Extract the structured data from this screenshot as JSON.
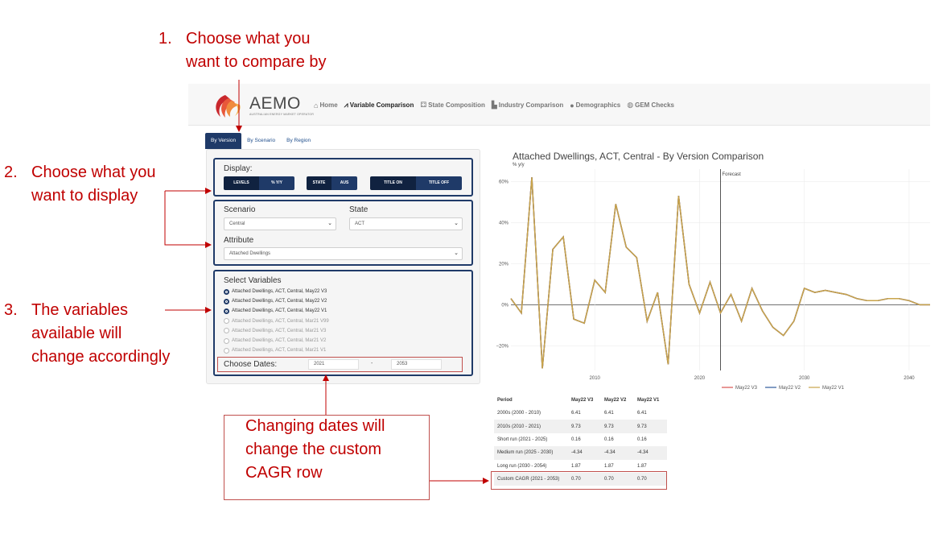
{
  "annotations": {
    "step1": {
      "num": "1.",
      "line1": "Choose what you",
      "line2": "want to compare by"
    },
    "step2": {
      "num": "2.",
      "line1": "Choose what you",
      "line2": "want to display"
    },
    "step3": {
      "num": "3.",
      "line1": "The variables",
      "line2": "available will",
      "line3": "change accordingly"
    },
    "dates_note": {
      "line1": "Changing dates will",
      "line2": "change the custom",
      "line3": "CAGR row"
    }
  },
  "logo": {
    "text": "AEMO",
    "subtitle": "AUSTRALIAN ENERGY MARKET OPERATOR"
  },
  "nav": [
    {
      "label": "Home",
      "icon": "home-icon",
      "glyph": "⌂"
    },
    {
      "label": "Variable Comparison",
      "icon": "line-chart-icon",
      "glyph": "⩘",
      "active": true
    },
    {
      "label": "State Composition",
      "icon": "sitemap-icon",
      "glyph": "⚃"
    },
    {
      "label": "Industry Comparison",
      "icon": "industry-icon",
      "glyph": "▙"
    },
    {
      "label": "Demographics",
      "icon": "user-icon",
      "glyph": "●"
    },
    {
      "label": "GEM Checks",
      "icon": "globe-icon",
      "glyph": "◍"
    }
  ],
  "tabs": [
    "By Version",
    "By Scenario",
    "By Region"
  ],
  "display": {
    "label": "Display:",
    "levels": "LEVELS",
    "pct": "% Y/Y",
    "state": "STATE",
    "aus": "AUS",
    "title_on": "TITLE ON",
    "title_off": "TITLE OFF"
  },
  "filters": {
    "scenario_label": "Scenario",
    "scenario_value": "Central",
    "state_label": "State",
    "state_value": "ACT",
    "attribute_label": "Attribute",
    "attribute_value": "Attached Dwellings"
  },
  "variables": {
    "label": "Select Variables",
    "items": [
      {
        "label": "Attached Dwellings, ACT, Central, May22 V3",
        "checked": true
      },
      {
        "label": "Attached Dwellings, ACT, Central, May22 V2",
        "checked": true
      },
      {
        "label": "Attached Dwellings, ACT, Central, May22 V1",
        "checked": true
      },
      {
        "label": "Attached Dwellings, ACT, Central, Mar21 V99",
        "checked": false
      },
      {
        "label": "Attached Dwellings, ACT, Central, Mar21 V3",
        "checked": false
      },
      {
        "label": "Attached Dwellings, ACT, Central, Mar21 V2",
        "checked": false
      },
      {
        "label": "Attached Dwellings, ACT, Central, Mar21 V1",
        "checked": false
      }
    ]
  },
  "dates": {
    "label": "Choose Dates:",
    "start": "2021",
    "separator": "-",
    "end": "2053"
  },
  "chart_data": {
    "type": "line",
    "title": "Attached Dwellings, ACT, Central - By Version Comparison",
    "ylabel": "% y/y",
    "forecast_label": "Forecast",
    "forecast_x": 2022,
    "xlim": [
      2002,
      2042
    ],
    "ylim": [
      -32,
      66
    ],
    "x_ticks": [
      2010,
      2020,
      2030,
      2040
    ],
    "y_ticks": [
      {
        "v": 60,
        "label": "60%"
      },
      {
        "v": 40,
        "label": "40%"
      },
      {
        "v": 20,
        "label": "20%"
      },
      {
        "v": 0,
        "label": "0%"
      },
      {
        "v": -20,
        "label": "−20%"
      }
    ],
    "x": [
      2002,
      2003,
      2004,
      2005,
      2006,
      2007,
      2008,
      2009,
      2010,
      2011,
      2012,
      2013,
      2014,
      2015,
      2016,
      2017,
      2018,
      2019,
      2020,
      2021,
      2022,
      2023,
      2024,
      2025,
      2026,
      2027,
      2028,
      2029,
      2030,
      2031,
      2032,
      2033,
      2034,
      2035,
      2036,
      2037,
      2038,
      2039,
      2040,
      2041,
      2042
    ],
    "series": [
      {
        "name": "May22 V3",
        "color": "#d9534f",
        "values": [
          3,
          -4,
          62,
          -31,
          27,
          33,
          -7,
          -9,
          12,
          6,
          49,
          28,
          23,
          -8,
          6,
          -29,
          53,
          10,
          -4,
          11,
          -4,
          5,
          -8,
          8,
          -3,
          -11,
          -15,
          -8,
          8,
          6,
          7,
          6,
          5,
          3,
          2,
          2,
          3,
          3,
          2,
          0,
          0
        ]
      },
      {
        "name": "May22 V2",
        "color": "#2e5a9c",
        "values": [
          3,
          -4,
          62,
          -31,
          27,
          33,
          -7,
          -9,
          12,
          6,
          49,
          28,
          23,
          -8,
          6,
          -29,
          53,
          10,
          -4,
          11,
          -4,
          5,
          -8,
          8,
          -3,
          -11,
          -15,
          -8,
          8,
          6,
          7,
          6,
          5,
          3,
          2,
          2,
          3,
          3,
          2,
          0,
          0
        ]
      },
      {
        "name": "May22 V1",
        "color": "#c9a44a",
        "values": [
          3,
          -4,
          62,
          -31,
          27,
          33,
          -7,
          -9,
          12,
          6,
          49,
          28,
          23,
          -8,
          6,
          -29,
          53,
          10,
          -4,
          11,
          -4,
          5,
          -8,
          8,
          -3,
          -11,
          -15,
          -8,
          8,
          6,
          7,
          6,
          5,
          3,
          2,
          2,
          3,
          3,
          2,
          0,
          0
        ]
      }
    ]
  },
  "table": {
    "headers": [
      "Period",
      "May22 V3",
      "May22 V2",
      "May22 V1"
    ],
    "rows": [
      [
        "2000s (2000 - 2010)",
        "6.41",
        "6.41",
        "6.41"
      ],
      [
        "2010s (2010 - 2021)",
        "9.73",
        "9.73",
        "9.73"
      ],
      [
        "Short run (2021 - 2025)",
        "0.16",
        "0.16",
        "0.16"
      ],
      [
        "Medium run (2025 - 2030)",
        "-4.34",
        "-4.34",
        "-4.34"
      ],
      [
        "Long run (2030 - 2054)",
        "1.87",
        "1.87",
        "1.87"
      ],
      [
        "Custom CAGR (2021 - 2053)",
        "0.70",
        "0.70",
        "0.70"
      ]
    ]
  },
  "colors": {
    "navy": "#1f3a68",
    "annotation_red": "#c00000",
    "box_red": "#c0504d"
  }
}
